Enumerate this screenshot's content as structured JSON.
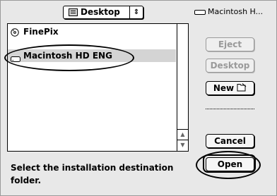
{
  "location_popup": {
    "label": "Desktop",
    "arrows": "⇕"
  },
  "file_list": {
    "items": [
      {
        "label": "FinePix",
        "icon": "cdrom-disc-icon",
        "selected": false
      },
      {
        "label": "Macintosh HD ENG",
        "icon": "hard-drive-icon",
        "selected": true
      }
    ],
    "scroll_up": "▲",
    "scroll_down": "▼"
  },
  "volume_name": "Macintosh H...",
  "buttons": {
    "eject": "Eject",
    "desktop": "Desktop",
    "new": "New",
    "cancel": "Cancel",
    "open": "Open"
  },
  "prompt_text": "Select the installation destination folder."
}
